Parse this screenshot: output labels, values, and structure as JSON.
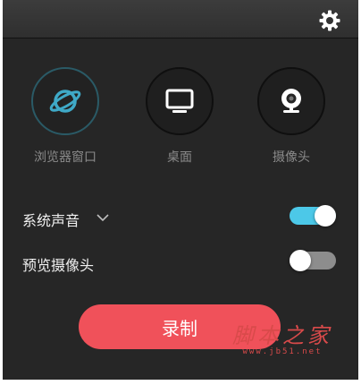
{
  "modes": [
    {
      "label": "浏览器窗口",
      "icon": "browser-globe-icon",
      "active": true
    },
    {
      "label": "桌面",
      "icon": "monitor-icon",
      "active": false
    },
    {
      "label": "摄像头",
      "icon": "webcam-icon",
      "active": false
    }
  ],
  "options": {
    "system_audio": {
      "label": "系统声音",
      "enabled": true
    },
    "preview_camera": {
      "label": "预览摄像头",
      "enabled": false
    }
  },
  "record_button": {
    "label": "录制"
  },
  "watermark": {
    "title": "脚本之家",
    "url": "www.jb51.net"
  },
  "colors": {
    "accent_toggle_on": "#4cc8e8",
    "toggle_off": "#8d8d8d",
    "record": "#f0515a",
    "globe": "#3fa9c7"
  }
}
